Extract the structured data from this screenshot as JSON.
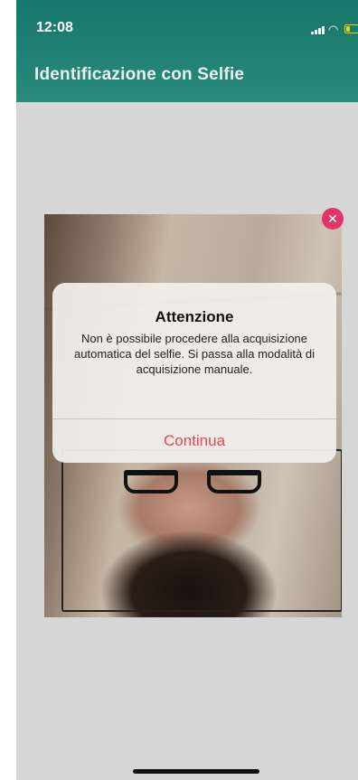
{
  "status_bar": {
    "time": "12:08"
  },
  "header": {
    "title": "Identificazione con Selfie"
  },
  "alert": {
    "title": "Attenzione",
    "message": "Non è possibile procedere alla acquisizione automatica del selfie. Si passa alla modalità di acquisizione manuale.",
    "button_label": "Continua"
  },
  "colors": {
    "header": "#16776a",
    "alert_button": "#e0475a",
    "close_badge": "#e0356a"
  }
}
